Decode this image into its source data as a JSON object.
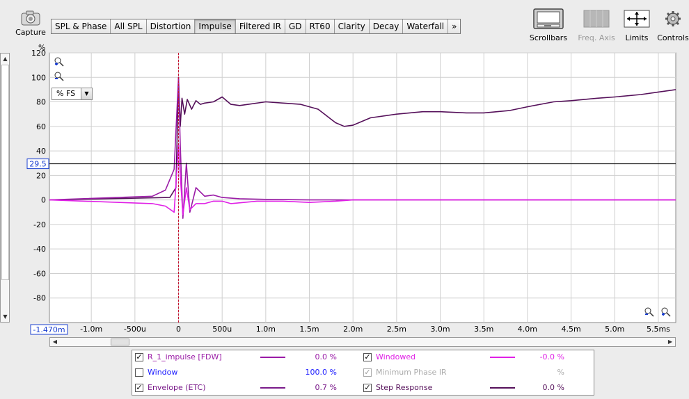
{
  "toolbar": {
    "capture_label": "Capture",
    "tabs": [
      {
        "label": "SPL & Phase"
      },
      {
        "label": "All SPL"
      },
      {
        "label": "Distortion"
      },
      {
        "label": "Impulse"
      },
      {
        "label": "Filtered IR"
      },
      {
        "label": "GD"
      },
      {
        "label": "RT60"
      },
      {
        "label": "Clarity"
      },
      {
        "label": "Decay"
      },
      {
        "label": "Waterfall"
      },
      {
        "label": "»"
      }
    ],
    "active_tab": "Impulse",
    "scrollbars_label": "Scrollbars",
    "freq_axis_label": "Freq. Axis",
    "limits_label": "Limits",
    "controls_label": "Controls"
  },
  "graph": {
    "y_unit": "%",
    "unit_select_value": "% FS",
    "cursor_y_value": "29.5",
    "cursor_x_value": "-1.470m"
  },
  "chart_data": {
    "type": "line",
    "xlabel": "",
    "ylabel": "%",
    "x_unit": "s",
    "xlim": [
      -0.00148,
      0.0057
    ],
    "ylim": [
      -100,
      120
    ],
    "x_tick_labels": [
      "-1.0m",
      "-500u",
      "0",
      "500u",
      "1.0m",
      "1.5m",
      "2.0m",
      "2.5m",
      "3.0m",
      "3.5m",
      "4.0m",
      "4.5m",
      "5.0m",
      "5.5ms"
    ],
    "x_ticks": [
      -0.001,
      -0.0005,
      0,
      0.0005,
      0.001,
      0.0015,
      0.002,
      0.0025,
      0.003,
      0.0035,
      0.004,
      0.0045,
      0.005,
      0.0055
    ],
    "y_tick_labels": [
      "120",
      "100",
      "80",
      "60",
      "40",
      "20",
      "0",
      "-20",
      "-40",
      "-60",
      "-80"
    ],
    "y_ticks": [
      120,
      100,
      80,
      60,
      40,
      20,
      0,
      -20,
      -40,
      -60,
      -80
    ],
    "grid": true,
    "horizontal_cursor": 29.5,
    "time_marker": 0,
    "series": [
      {
        "name": "Step Response",
        "color": "#55105a",
        "x": [
          -0.00148,
          -0.0001,
          -3e-05,
          0.0,
          2e-05,
          4e-05,
          7e-05,
          0.0001,
          0.00015,
          0.0002,
          0.00025,
          0.0003,
          0.0004,
          0.0005,
          0.0006,
          0.0007,
          0.0008,
          0.001,
          0.0012,
          0.0014,
          0.0016,
          0.0018,
          0.0019,
          0.002,
          0.0022,
          0.0025,
          0.0028,
          0.003,
          0.0033,
          0.0035,
          0.0038,
          0.004,
          0.0043,
          0.0045,
          0.0048,
          0.005,
          0.0053,
          0.0055,
          0.0057
        ],
        "values": [
          0,
          2,
          10,
          100,
          60,
          83,
          70,
          82,
          74,
          81,
          78,
          79,
          80,
          84,
          78,
          77,
          78,
          80,
          79,
          78,
          74,
          63,
          60,
          61,
          67,
          70,
          72,
          72,
          71,
          71,
          73,
          76,
          80,
          81,
          83,
          84,
          86,
          88,
          90
        ]
      },
      {
        "name": "R_1_impulse [FDW]",
        "color": "#9a1aa6",
        "x": [
          -0.00148,
          -0.0003,
          -0.00015,
          -5e-05,
          0.0,
          2e-05,
          5e-05,
          9e-05,
          0.00013,
          0.0002,
          0.0003,
          0.0004,
          0.0005,
          0.0007,
          0.001,
          0.0015,
          0.002,
          0.003,
          0.004,
          0.005,
          0.0057
        ],
        "values": [
          0,
          3,
          8,
          25,
          100,
          45,
          -15,
          30,
          -10,
          10,
          3,
          4,
          2,
          1,
          0.5,
          0,
          0,
          0,
          0,
          0,
          0
        ]
      },
      {
        "name": "Windowed",
        "color": "#e020e6",
        "x": [
          -0.00148,
          -0.0003,
          -0.00015,
          -5e-05,
          0.0,
          2e-05,
          5e-05,
          9e-05,
          0.00013,
          0.0002,
          0.0003,
          0.0004,
          0.0005,
          0.0006,
          0.0009,
          0.0012,
          0.0015,
          0.0018,
          0.002,
          0.003,
          0.004,
          0.005,
          0.0057
        ],
        "values": [
          0,
          -3,
          -5,
          -10,
          45,
          20,
          -12,
          10,
          -8,
          -3,
          -3,
          -1,
          -1,
          -3,
          -1,
          -1,
          -2,
          -1,
          0,
          0,
          0,
          0,
          0
        ]
      }
    ]
  },
  "hscroll": {
    "left_arrow": "◀",
    "right_arrow": "▶"
  },
  "legend": {
    "rows": [
      {
        "checked": "✓",
        "name": "R_1_impulse [FDW]",
        "value": "0.0 %",
        "color": "#9a1aa6"
      },
      {
        "checked": "✓",
        "name": "Windowed",
        "value": "-0.0 %",
        "color": "#e020e6"
      },
      {
        "checked": "",
        "name": "Window",
        "value": "100.0 %",
        "color": "#1a1aff"
      },
      {
        "checked": "✓",
        "name": "Minimum Phase IR",
        "value": "%",
        "color": "#aaaaaa"
      },
      {
        "checked": "✓",
        "name": "Envelope (ETC)",
        "value": "0.7 %",
        "color": "#7a1a8a"
      },
      {
        "checked": "✓",
        "name": "Step Response",
        "value": "0.0 %",
        "color": "#55105a"
      }
    ]
  }
}
